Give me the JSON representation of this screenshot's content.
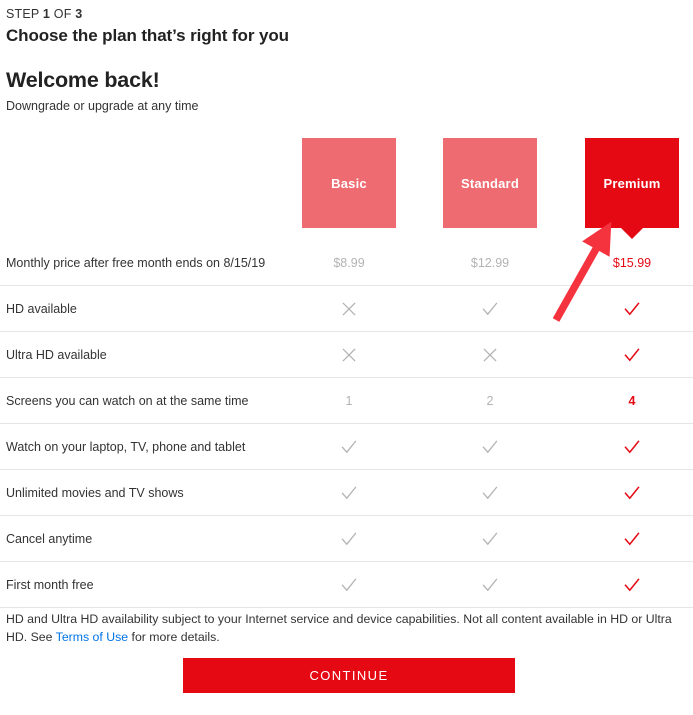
{
  "header": {
    "step_prefix": "STEP",
    "step_current": "1",
    "step_middle": "OF",
    "step_total": "3",
    "step_title": "Choose the plan that’s right for you",
    "welcome": "Welcome back!",
    "subtitle": "Downgrade or upgrade at any time"
  },
  "colors": {
    "accent_red": "#e50914",
    "card_unselected": "#ef6b72",
    "link_blue": "#0073e6",
    "muted_gray": "#b3b3b3",
    "divider": "#e6e6e6"
  },
  "plans": [
    {
      "name": "Basic",
      "price": "$8.99",
      "selected": false
    },
    {
      "name": "Standard",
      "price": "$12.99",
      "selected": false
    },
    {
      "name": "Premium",
      "price": "$15.99",
      "selected": true
    }
  ],
  "table": {
    "rows": [
      {
        "label": "Monthly price after free month ends on 8/15/19",
        "type": "price",
        "values": [
          "$8.99",
          "$12.99",
          "$15.99"
        ]
      },
      {
        "label": "HD available",
        "type": "mark",
        "values": [
          "cross",
          "check",
          "check"
        ]
      },
      {
        "label": "Ultra HD available",
        "type": "mark",
        "values": [
          "cross",
          "cross",
          "check"
        ]
      },
      {
        "label": "Screens you can watch on at the same time",
        "type": "number",
        "values": [
          "1",
          "2",
          "4"
        ]
      },
      {
        "label": "Watch on your laptop, TV, phone and tablet",
        "type": "mark",
        "values": [
          "check",
          "check",
          "check"
        ]
      },
      {
        "label": "Unlimited movies and TV shows",
        "type": "mark",
        "values": [
          "check",
          "check",
          "check"
        ]
      },
      {
        "label": "Cancel anytime",
        "type": "mark",
        "values": [
          "check",
          "check",
          "check"
        ]
      },
      {
        "label": "First month free",
        "type": "mark",
        "values": [
          "check",
          "check",
          "check"
        ]
      }
    ]
  },
  "footnote": {
    "text_before": "HD and Ultra HD availability subject to your Internet service and device capabilities. Not all content available in HD or Ultra HD. See ",
    "link_text": "Terms of Use",
    "text_after": " for more details."
  },
  "continue_button": {
    "label": "CONTINUE"
  },
  "annotation": {
    "arrow_color": "#f5333f",
    "points_to": "premium-plan-card"
  }
}
